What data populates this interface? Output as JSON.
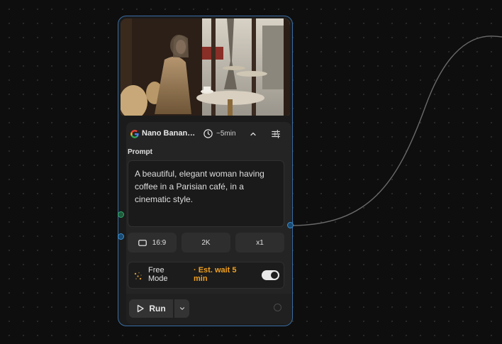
{
  "node": {
    "model_name": "Nano Banana Pro",
    "duration": "~5min",
    "prompt_label": "Prompt",
    "prompt_text": "A beautiful, elegant woman having coffee in a Parisian café, in a cinematic style.",
    "options": {
      "aspect_ratio": "16:9",
      "resolution": "2K",
      "count": "x1"
    },
    "free_mode": {
      "label": "Free Mode",
      "wait_text": "· Est. wait 5 min",
      "enabled": true
    },
    "run_label": "Run"
  },
  "icons": [
    "google-logo-icon",
    "clock-icon",
    "chevron-up-icon",
    "sliders-icon",
    "aspect-ratio-icon",
    "sparkle-icon",
    "play-icon",
    "chevron-down-icon"
  ],
  "colors": {
    "node_border": "#3a6ea5",
    "wait_text": "#f0a020",
    "port_blue": "#3a8fd0",
    "port_green": "#2fa86a"
  }
}
